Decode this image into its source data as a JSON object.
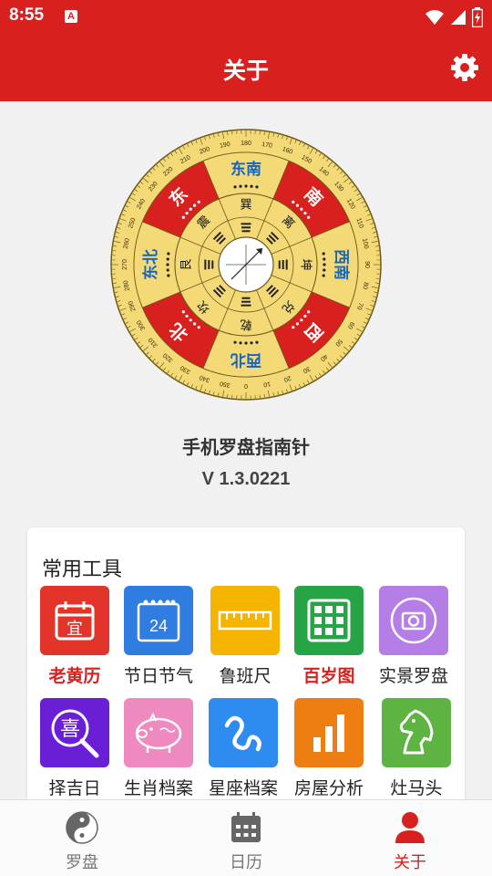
{
  "status_bar": {
    "time": "8:55",
    "notif_icon_letter": "A"
  },
  "app_bar": {
    "title": "关于",
    "settings_icon": "gear-icon"
  },
  "compass": {
    "directions": [
      "东南",
      "南",
      "西南",
      "西",
      "西北",
      "北",
      "东北",
      "东"
    ],
    "trigrams": [
      "巽",
      "离",
      "坤",
      "兑",
      "乾",
      "坎",
      "艮",
      "震"
    ],
    "degree_labels": [
      "0",
      "10",
      "20",
      "30",
      "40",
      "50",
      "60",
      "70",
      "80",
      "90",
      "100",
      "110",
      "120",
      "130",
      "140",
      "150",
      "160",
      "170",
      "180",
      "190",
      "200",
      "210",
      "220",
      "230",
      "240",
      "250",
      "260",
      "270",
      "280",
      "290",
      "300",
      "310",
      "320",
      "330",
      "340",
      "350"
    ]
  },
  "about": {
    "app_name": "手机罗盘指南针",
    "version": "V 1.3.0221"
  },
  "tools": {
    "title": "常用工具",
    "items": [
      {
        "label": "老黄历",
        "highlight": true,
        "icon": "calendar-yi-icon",
        "color": "#e2342a",
        "glyph": "宜"
      },
      {
        "label": "节日节气",
        "highlight": false,
        "icon": "calendar-24-icon",
        "color": "#2f7de1",
        "glyph": "24"
      },
      {
        "label": "鲁班尺",
        "highlight": false,
        "icon": "ruler-icon",
        "color": "#f5b400"
      },
      {
        "label": "百岁图",
        "highlight": true,
        "icon": "grid-icon",
        "color": "#27a546"
      },
      {
        "label": "实景罗盘",
        "highlight": false,
        "icon": "camera-icon",
        "color": "#b57de6"
      },
      {
        "label": "择吉日",
        "highlight": false,
        "icon": "xi-search-icon",
        "color": "#6a1fd6",
        "glyph": "喜"
      },
      {
        "label": "生肖档案",
        "highlight": false,
        "icon": "pig-icon",
        "color": "#ef8ac0"
      },
      {
        "label": "星座档案",
        "highlight": false,
        "icon": "zodiac-icon",
        "color": "#2e8cf0"
      },
      {
        "label": "房屋分析",
        "highlight": false,
        "icon": "bar-chart-icon",
        "color": "#ee7d12"
      },
      {
        "label": "灶马头",
        "highlight": false,
        "icon": "horse-icon",
        "color": "#5db443"
      }
    ]
  },
  "nav": {
    "items": [
      {
        "label": "罗盘",
        "icon": "taiji-icon",
        "active": false
      },
      {
        "label": "日历",
        "icon": "calendar-icon",
        "active": false
      },
      {
        "label": "关于",
        "icon": "person-icon",
        "active": true
      }
    ],
    "active_color": "#d8201f"
  },
  "colors": {
    "primary": "#d8201f",
    "compass_yellow": "#f4d977",
    "compass_blue": "#1565c0"
  }
}
